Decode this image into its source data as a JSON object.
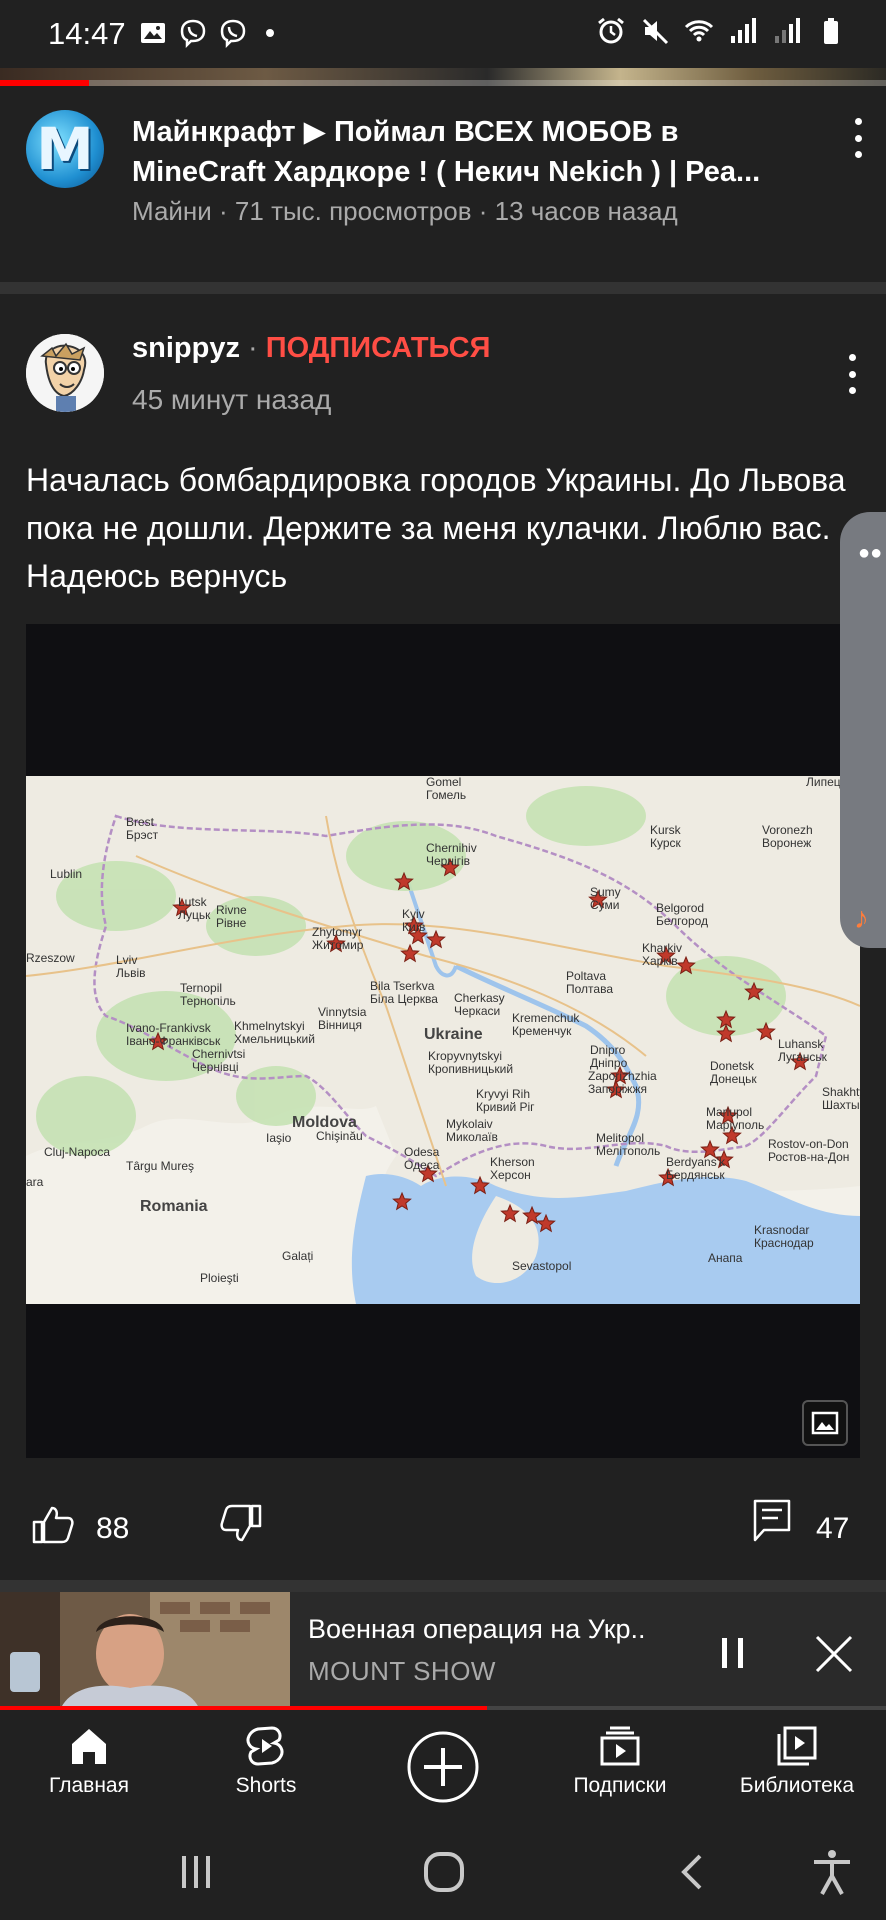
{
  "status_bar": {
    "time": "14:47",
    "left_icons": [
      "gallery-icon",
      "viber-icon",
      "viber-icon",
      "dot-icon"
    ],
    "right_icons": [
      "alarm-icon",
      "mute-icon",
      "wifi-icon",
      "signal-icon",
      "signal-icon",
      "battery-icon"
    ]
  },
  "video": {
    "title": "Майнкрафт ▶ Поймал ВСЕХ МОБОВ в MineCraft Хардкоре ! ( Некич Nekich ) | Реа...",
    "meta": "Майни · 71 тыс. просмотров · 13 часов назад",
    "avatar_letter": "M",
    "progress_fraction": 0.1
  },
  "post": {
    "author": "snippyz",
    "separator": " · ",
    "subscribe_label": "ПОДПИСАТЬСЯ",
    "time": "45 минут назад",
    "text": "Началась бомбардировка городов Украины. До Львова пока не дошли. Держите за меня кулачки. Люблю вас. Надеюсь вернусь",
    "likes": "88",
    "comments": "47"
  },
  "map": {
    "country_label": "Ukraine",
    "labels": [
      {
        "name": "Gomel\nГомель"
      },
      {
        "name": "Липецк"
      },
      {
        "name": "Brest\nБрэст"
      },
      {
        "name": "Chernihiv\nЧернігів"
      },
      {
        "name": "Kursk\nКурск"
      },
      {
        "name": "Voronezh\nВоронеж"
      },
      {
        "name": "Lublin"
      },
      {
        "name": "Sumy\nСуми"
      },
      {
        "name": "Lutsk\nЛуцьк"
      },
      {
        "name": "Rivne\nРівне"
      },
      {
        "name": "Zhytomyr\nЖитомир"
      },
      {
        "name": "Kyiv\nКиїв"
      },
      {
        "name": "Belgorod\nБелгород"
      },
      {
        "name": "Kharkiv\nХарків"
      },
      {
        "name": "Rzeszow"
      },
      {
        "name": "Lviv\nЛьвів"
      },
      {
        "name": "Bila Tserkva\nБіла Церква"
      },
      {
        "name": "Poltava\nПолтава"
      },
      {
        "name": "Ternopil\nТернопіль"
      },
      {
        "name": "Cherkasy\nЧеркаси"
      },
      {
        "name": "Vinnytsia\nВінниця"
      },
      {
        "name": "Kremenchuk\nКременчук"
      },
      {
        "name": "Khmelnytskyi\nХмельницький"
      },
      {
        "name": "Ivano-Frankivsk\nІвано-Франківськ"
      },
      {
        "name": "Luhansk\nЛуганськ"
      },
      {
        "name": "Dnipro\nДніпро"
      },
      {
        "name": "Chernivtsi\nЧернівці"
      },
      {
        "name": "Kropyvnytskyi\nКропивницький"
      },
      {
        "name": "Donetsk\nДонецьк"
      },
      {
        "name": "Zaporizhzhia\nЗапоріжжя"
      },
      {
        "name": "Kryvyi Rih\nКривий Ріг"
      },
      {
        "name": "Shakhty\nШахты"
      },
      {
        "name": "Moldova"
      },
      {
        "name": "Mariupol\nМаріуполь"
      },
      {
        "name": "Mykolaiv\nМиколаїв"
      },
      {
        "name": "Iaşio"
      },
      {
        "name": "Chişinău"
      },
      {
        "name": "Melitopol\nМелітополь"
      },
      {
        "name": "Rostov-on-Don\nРостов-на-Дон"
      },
      {
        "name": "Cluj-Napoca"
      },
      {
        "name": "Târgu Mureş"
      },
      {
        "name": "Odesa\nОдеса"
      },
      {
        "name": "Kherson\nХерсон"
      },
      {
        "name": "Berdyans'k\nБердянськ"
      },
      {
        "name": "Romania"
      },
      {
        "name": "Krasnodar\nКраснодар"
      },
      {
        "name": "Galați"
      },
      {
        "name": "Sevastopol"
      },
      {
        "name": "Анапа"
      },
      {
        "name": "Ploieşti"
      },
      {
        "name": "ara"
      }
    ]
  },
  "mini_player": {
    "title": "Военная операция на Укр..",
    "channel": "MOUNT SHOW",
    "progress_fraction": 0.55
  },
  "bottom_nav": [
    {
      "label": "Главная",
      "icon": "home-icon"
    },
    {
      "label": "Shorts",
      "icon": "shorts-icon"
    },
    {
      "label": "",
      "icon": "create-icon"
    },
    {
      "label": "Подписки",
      "icon": "subscriptions-icon"
    },
    {
      "label": "Библиотека",
      "icon": "library-icon"
    }
  ],
  "system_nav": [
    "recents-icon",
    "home-button-icon",
    "back-icon",
    "accessibility-icon"
  ],
  "colors": {
    "background": "#212121",
    "accent_red": "#ff4e45",
    "progress_red": "#ff0000",
    "secondary_text": "#aaaaaa"
  }
}
